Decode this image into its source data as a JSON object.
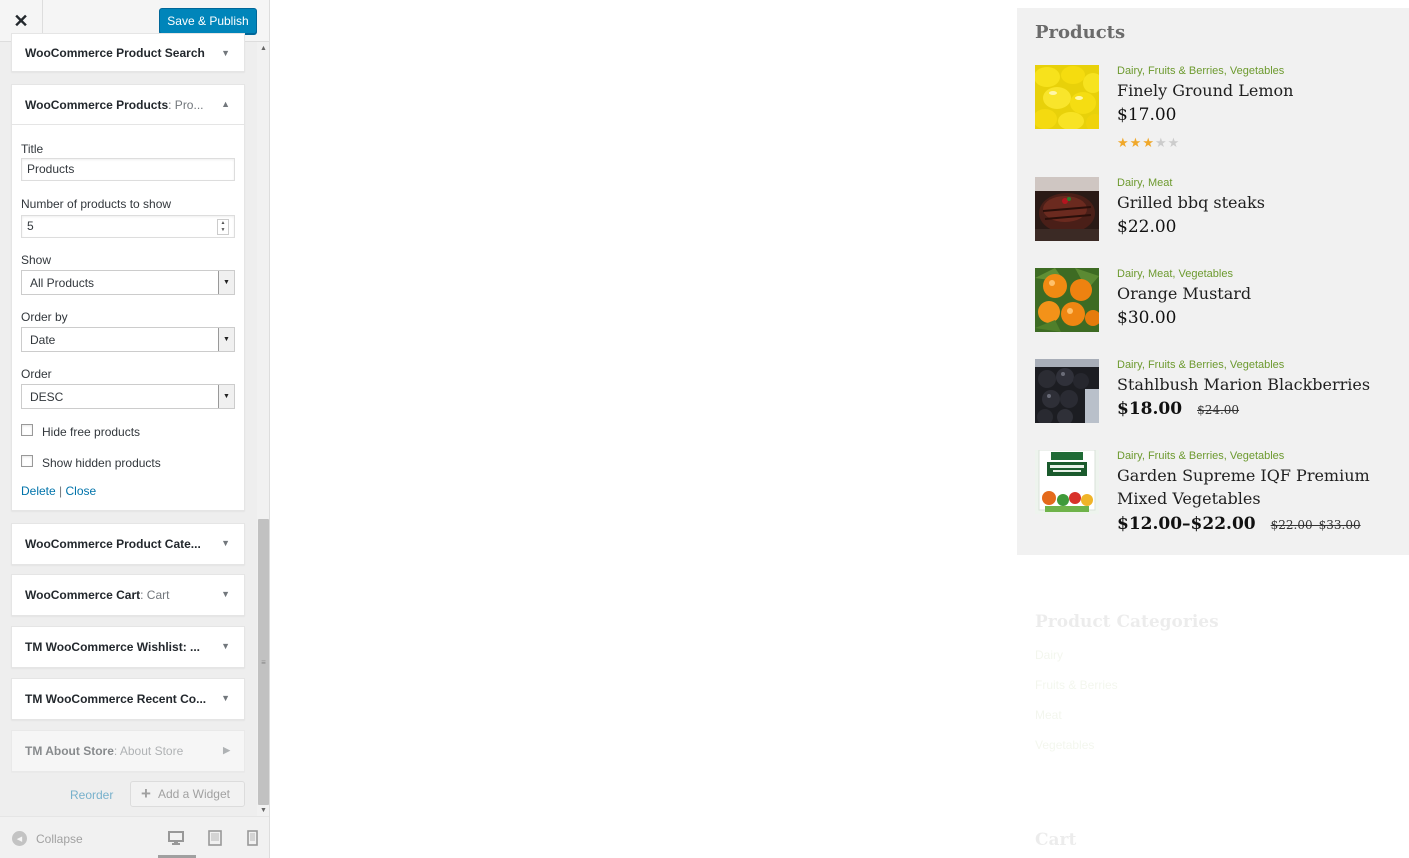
{
  "header": {
    "close_label": "✕",
    "publish_label": "Save & Publish"
  },
  "widgets": {
    "product_search": {
      "title": "WooCommerce Product Search",
      "subtitle": ""
    },
    "products": {
      "title": "WooCommerce Products",
      "subtitle": ": Pro..."
    },
    "product_categories": {
      "title": "WooCommerce Product Cate...",
      "subtitle": ""
    },
    "cart": {
      "title": "WooCommerce Cart",
      "subtitle": ": Cart"
    },
    "wishlist": {
      "title": "TM WooCommerce Wishlist: ...",
      "subtitle": ""
    },
    "recent": {
      "title": "TM WooCommerce Recent Co...",
      "subtitle": ""
    },
    "about": {
      "title": "TM About Store",
      "subtitle": ": About Store"
    }
  },
  "form": {
    "title_label": "Title",
    "title_value": "Products",
    "number_label": "Number of products to show",
    "number_value": "5",
    "show_label": "Show",
    "show_value": "All Products",
    "orderby_label": "Order by",
    "orderby_value": "Date",
    "order_label": "Order",
    "order_value": "DESC",
    "hide_free_label": "Hide free products",
    "hide_free_checked": false,
    "show_hidden_label": "Show hidden products",
    "show_hidden_checked": false,
    "delete_label": "Delete",
    "separator": "|",
    "close_label": "Close"
  },
  "actions": {
    "reorder_label": "Reorder",
    "add_widget_label": "Add a Widget"
  },
  "footer": {
    "collapse_label": "Collapse",
    "active_device": "desktop"
  },
  "preview": {
    "products_title": "Products",
    "products": [
      {
        "categories": "Dairy, Fruits & Berries, Vegetables",
        "name": "Finely Ground Lemon",
        "price": "$17.00",
        "old_price": "",
        "rating": 3,
        "rating_max": 5,
        "image": "lemons"
      },
      {
        "categories": "Dairy, Meat",
        "name": "Grilled bbq steaks",
        "price": "$22.00",
        "old_price": "",
        "image": "steak"
      },
      {
        "categories": "Dairy, Meat, Vegetables",
        "name": "Orange Mustard",
        "price": "$30.00",
        "old_price": "",
        "image": "oranges"
      },
      {
        "categories": "Dairy, Fruits & Berries, Vegetables",
        "name": "Stahlbush Marion Blackberries",
        "price": "$18.00",
        "old_price": "$24.00",
        "image": "blackberries"
      },
      {
        "categories": "Dairy, Fruits & Berries, Vegetables",
        "name": "Garden Supreme IQF Premium Mixed Vegetables",
        "price": "$12.00–$22.00",
        "old_price": "$22.00–$33.00",
        "image": "vegetables-bag"
      }
    ],
    "categories_title": "Product Categories",
    "categories": [
      "Dairy",
      "Fruits & Berries",
      "Meat",
      "Vegetables"
    ],
    "cart_title": "Cart"
  },
  "colors": {
    "primary_button": "#0085ba",
    "link": "#0073aa",
    "category_green": "#6d9a2f",
    "panel_bg": "#f1f1f1",
    "star": "#f0a82a"
  },
  "icons": {
    "close": "close-icon",
    "collapse": "collapse-icon",
    "plus": "plus-icon",
    "chevron": "chevron-down-icon",
    "desktop": "desktop-icon",
    "tablet": "tablet-icon",
    "mobile": "mobile-icon"
  }
}
